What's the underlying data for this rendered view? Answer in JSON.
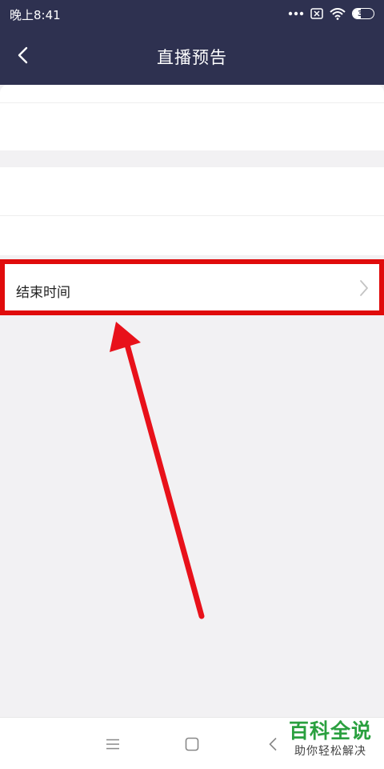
{
  "status_bar": {
    "time": "晚上8:41",
    "battery_level": "39",
    "icons": [
      "more-dots-icon",
      "sim-off-icon",
      "wifi-icon",
      "battery-icon"
    ]
  },
  "header": {
    "title": "直播预告",
    "back_icon": "chevron-left-icon"
  },
  "settings": {
    "end_time_label": "结束时间"
  },
  "system_nav": {
    "icons": [
      "menu-icon",
      "home-square-icon",
      "back-chevron-icon"
    ]
  },
  "watermark": {
    "main": "百科全说",
    "sub": "助你轻松解决"
  },
  "colors": {
    "header_bg": "#2e3150",
    "highlight_red": "#e00b0b",
    "page_bg": "#f2f1f3",
    "watermark_green": "#2aa03f"
  }
}
